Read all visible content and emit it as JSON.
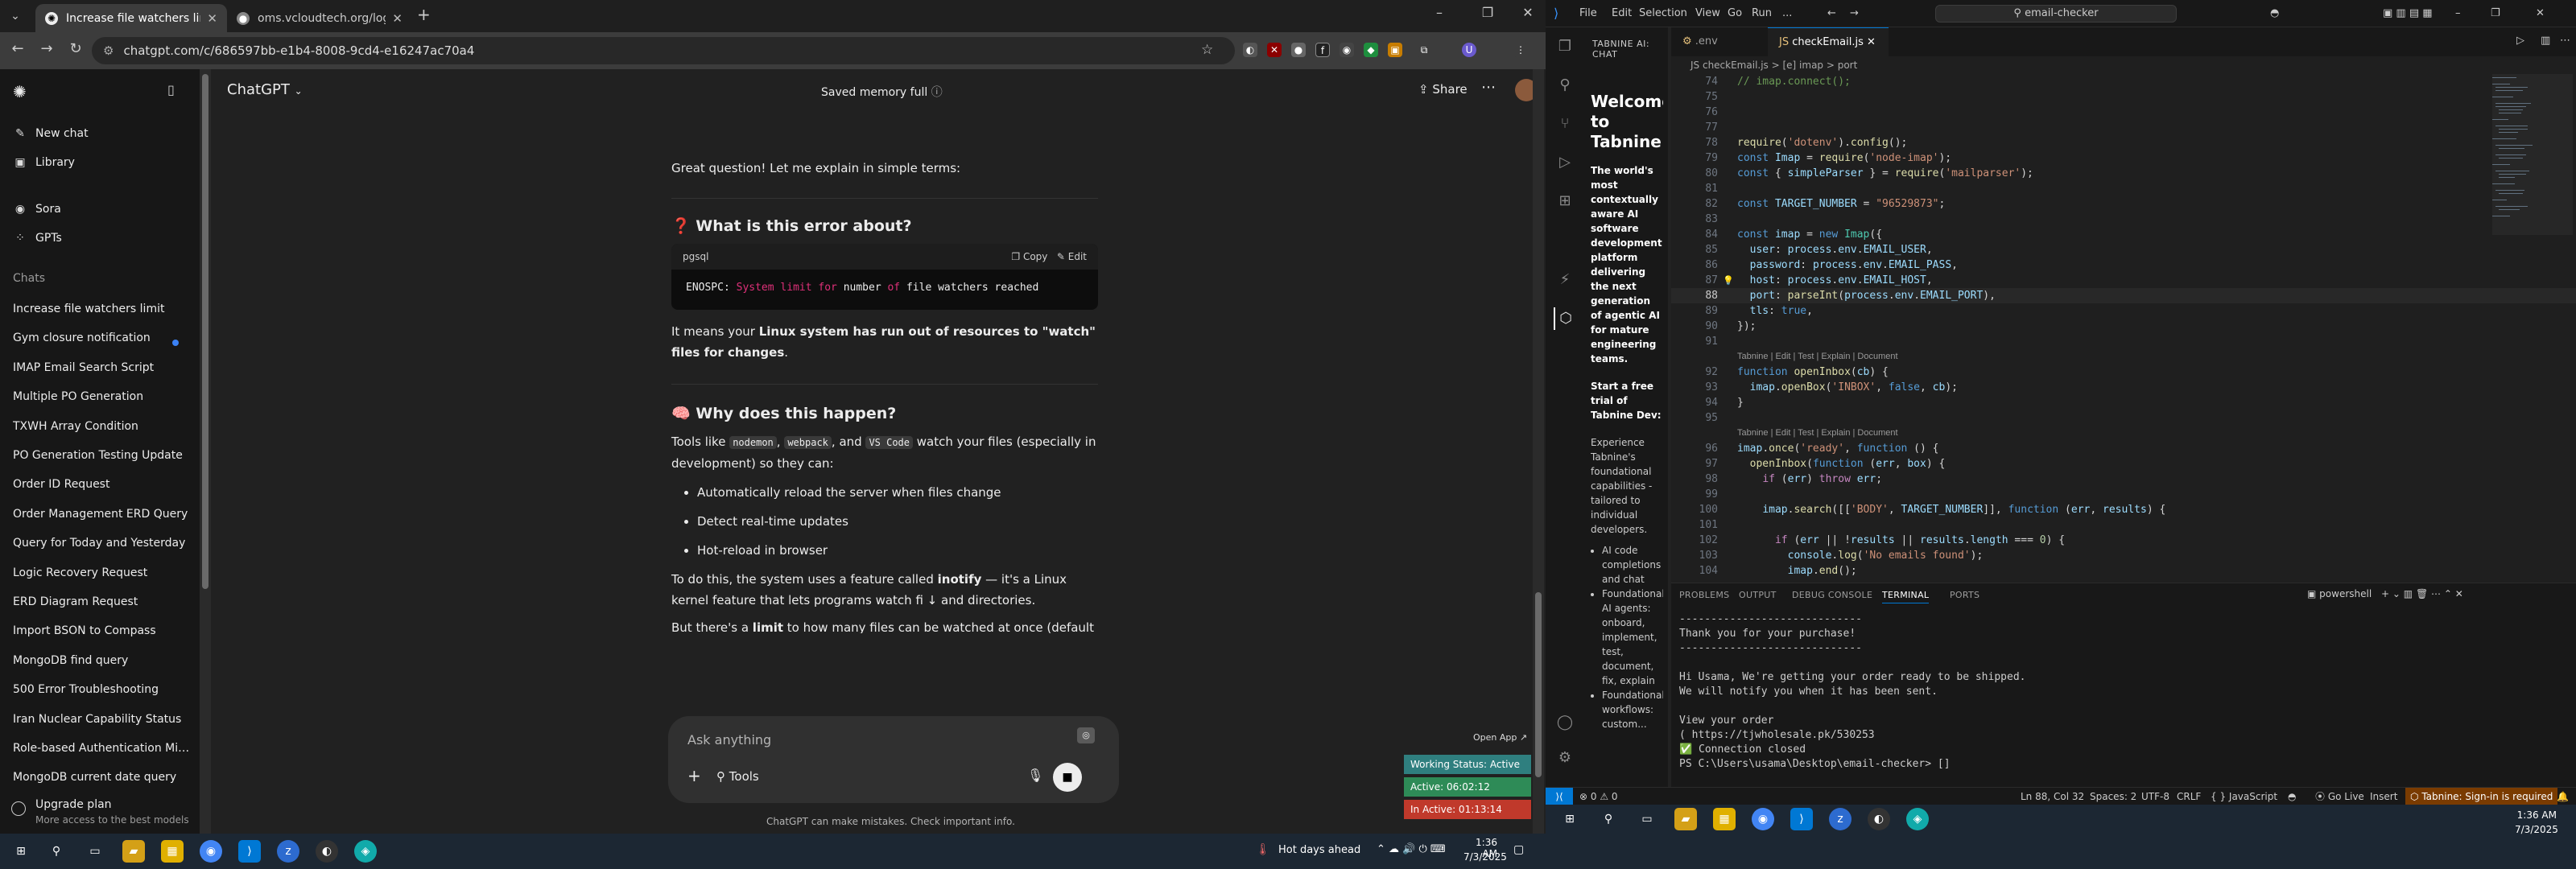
{
  "browser": {
    "tabs": [
      {
        "label": "Increase file watchers limit",
        "active": true
      },
      {
        "label": "oms.vcloudtech.org/login",
        "active": false
      }
    ],
    "url": "chatgpt.com/c/686597bb-e1b4-8008-9cd4-e16247ac70a4"
  },
  "chat_sidebar": {
    "new_chat": "New chat",
    "library": "Library",
    "sora": "Sora",
    "gpts": "GPTs",
    "chats_heading": "Chats",
    "chats": [
      "Increase file watchers limit",
      "Gym closure notification",
      "IMAP Email Search Script",
      "Multiple PO Generation",
      "TXWH Array Condition",
      "PO Generation Testing Update",
      "Order ID Request",
      "Order Management ERD Query",
      "Query for Today and Yesterday",
      "Logic Recovery Request",
      "ERD Diagram Request",
      "Import BSON to Compass",
      "MongoDB find query",
      "500 Error Troubleshooting",
      "Iran Nuclear Capability Status",
      "Role-based Authentication Mid...",
      "MongoDB current date query"
    ],
    "upgrade_title": "Upgrade plan",
    "upgrade_sub": "More access to the best models"
  },
  "chat_header": {
    "model": "ChatGPT",
    "memory": "Saved memory full",
    "share": "Share"
  },
  "message": {
    "intro": "Great question! Let me explain in simple terms:",
    "h1": "❓ What is this error about?",
    "code_lang": "pgsql",
    "copy": "Copy",
    "edit": "Edit",
    "code_a": "ENOSPC: ",
    "code_b": "System limit ",
    "code_c": "for ",
    "code_d": "number ",
    "code_e": "of ",
    "code_f": "file watchers reached",
    "p1a": "It means your ",
    "p1b": "Linux system has run out of resources to \"watch\" files for changes",
    "p1c": ".",
    "h2": "🧠 Why does this happen?",
    "p2a": "Tools like ",
    "p2b": "nodemon",
    "p2c": ", ",
    "p2d": "webpack",
    "p2e": ", and ",
    "p2f": "VS Code",
    "p2g": " watch your files (especially in development) so they can:",
    "bullets": [
      "Automatically reload the server when files change",
      "Detect real-time updates",
      "Hot-reload in browser"
    ],
    "p3a": "To do this, the system uses a feature called ",
    "p3b": "inotify",
    "p3c": " — it's a Linux kernel feature that lets programs watch fi",
    "p3d": "and directories.",
    "p4a": "But there's a ",
    "p4b": "limit",
    "p4c": " to how many files can be watched at once (default is"
  },
  "composer": {
    "placeholder": "Ask anything",
    "tools": "Tools",
    "disclaimer": "ChatGPT can make mistakes. Check important info."
  },
  "tracker": {
    "open_app": "Open App ↗",
    "status": "Working Status: Active",
    "active": "Active: 06:02:12",
    "inactive": "In Active: 01:13:14"
  },
  "taskbar_left": {
    "weather": "Hot days ahead",
    "time": "1:36 AM",
    "date": "7/3/2025"
  },
  "vscode": {
    "menus": [
      "File",
      "Edit",
      "Selection",
      "View",
      "Go",
      "Run",
      "..."
    ],
    "search": "email-checker",
    "tabnine_heading": "TABNINE AI: CHAT",
    "tabnine_welcome": "Welcome to Tabnine",
    "tabnine_p1": "The world's most contextually aware AI software development platform delivering the next generation of agentic AI for mature engineering teams.",
    "tabnine_p2": "Start a free trial of Tabnine Dev:",
    "tabnine_p3": "Experience Tabnine's foundational capabilities - tailored to individual developers.",
    "tabnine_list": [
      "AI code completions and chat",
      "Foundational AI agents: onboard, implement, test, document, fix, explain",
      "Foundational workflows: custom..."
    ],
    "tabs": [
      ".env",
      "checkEmail.js"
    ],
    "breadcrumb": "JS checkEmail.js  >  [e] imap  >  port",
    "codelens": "Tabnine | Edit | Test | Explain | Document",
    "panel_tabs": [
      "PROBLEMS",
      "OUTPUT",
      "DEBUG CONSOLE",
      "TERMINAL",
      "PORTS"
    ],
    "shell": "powershell",
    "terminal": [
      "-----------------------------",
      "Thank you for your purchase!",
      "-----------------------------",
      "",
      "Hi Usama, We're getting your order ready to be shipped.",
      "We will notify you when it has been sent.",
      "",
      "View your order",
      "( https://tjwholesale.pk/530253",
      "✅ Connection closed",
      "PS C:\\Users\\usama\\Desktop\\email-checker> []"
    ],
    "status": {
      "errors": "⊗ 0 ⚠ 0",
      "position": "Ln 88, Col 32",
      "spaces": "Spaces: 2",
      "encoding": "UTF-8",
      "eol": "CRLF",
      "lang": "{ } JavaScript",
      "golive": "Go Live",
      "insert": "Insert",
      "tabnine": "Tabnine: Sign-in is required"
    }
  },
  "taskbar_right": {
    "time": "1:36 AM",
    "date": "7/3/2025"
  },
  "colors": {
    "chat_bg": "#212121",
    "sidebar_bg": "#171717",
    "vscode_bg": "#1f1f1f",
    "accent": "#0078d4",
    "status_green": "#2e8b57",
    "status_red": "#c0392b",
    "status_teal": "#2f7f7f"
  }
}
